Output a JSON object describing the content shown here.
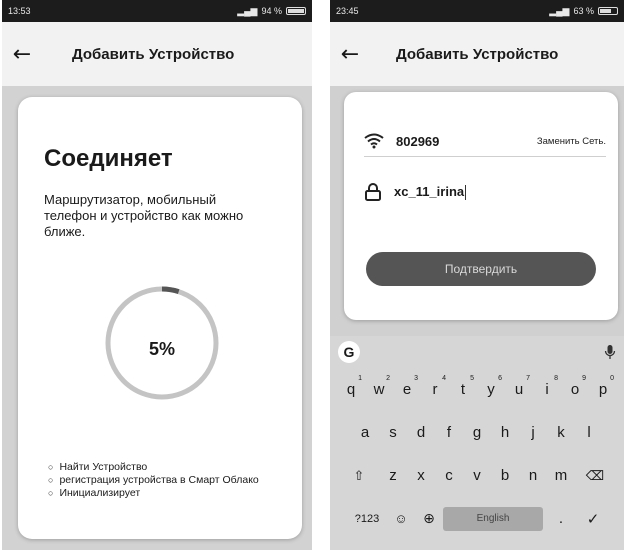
{
  "left": {
    "status_time": "13:53",
    "status_battery": "94 %",
    "title": "Добавить Устройство",
    "heading": "Соединяет",
    "description": "Маршрутизатор, мобильный телефон и устройство как можно ближе.",
    "progress_label": "5%",
    "progress_value": 5,
    "steps": [
      "Найти Устройство",
      "регистрация устройства в Смарт Облако",
      "Инициализирует"
    ]
  },
  "right": {
    "status_time": "23:45",
    "status_battery": "63 %",
    "title": "Добавить Устройство",
    "ssid": "802969",
    "change_network": "Заменить Сеть.",
    "password": "xc_11_irina",
    "confirm_label": "Подтвердить"
  },
  "keyboard": {
    "row1": [
      "q",
      "w",
      "e",
      "r",
      "t",
      "y",
      "u",
      "i",
      "o",
      "p"
    ],
    "row1_hints": [
      "1",
      "2",
      "3",
      "4",
      "5",
      "6",
      "7",
      "8",
      "9",
      "0"
    ],
    "row2": [
      "a",
      "s",
      "d",
      "f",
      "g",
      "h",
      "j",
      "k",
      "l"
    ],
    "row3": [
      "z",
      "x",
      "c",
      "v",
      "b",
      "n",
      "m"
    ],
    "numbers_key": "?123",
    "space_label": "English",
    "period": "."
  },
  "icons": [
    "back-arrow-icon",
    "wifi-icon",
    "lock-icon",
    "google-icon",
    "mic-icon",
    "shift-icon",
    "backspace-icon",
    "emoji-icon",
    "globe-icon",
    "checkmark-icon"
  ]
}
